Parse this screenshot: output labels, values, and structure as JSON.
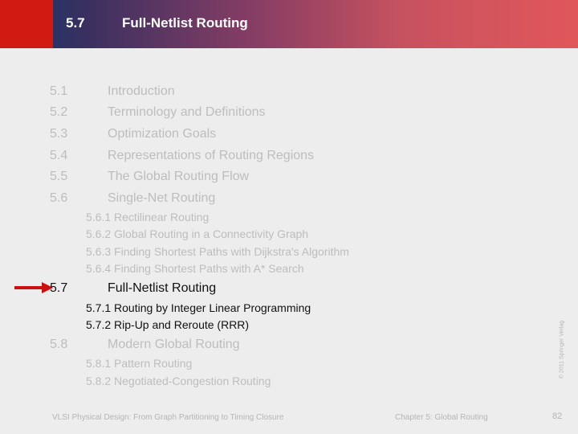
{
  "header": {
    "section_number": "5.7",
    "section_title": "Full-Netlist Routing",
    "colors": {
      "left_block": "#d01a12",
      "gradient_start": "#13386a",
      "gradient_end": "#e0575a"
    }
  },
  "toc": {
    "active_section": "5.7",
    "sections": [
      {
        "number": "5.1",
        "title": "Introduction",
        "subsections": []
      },
      {
        "number": "5.2",
        "title": "Terminology and Definitions",
        "subsections": []
      },
      {
        "number": "5.3",
        "title": "Optimization Goals",
        "subsections": []
      },
      {
        "number": "5.4",
        "title": "Representations of Routing Regions",
        "subsections": []
      },
      {
        "number": "5.5",
        "title": "The Global Routing Flow",
        "subsections": []
      },
      {
        "number": "5.6",
        "title": "Single-Net Routing",
        "subsections": [
          "5.6.1 Rectilinear Routing",
          "5.6.2 Global Routing in a Connectivity Graph",
          "5.6.3 Finding Shortest Paths with Dijkstra's Algorithm",
          "5.6.4 Finding Shortest Paths with A* Search"
        ]
      },
      {
        "number": "5.7",
        "title": "Full-Netlist Routing",
        "subsections": [
          "5.7.1 Routing by Integer Linear Programming",
          "5.7.2 Rip-Up and Reroute (RRR)"
        ]
      },
      {
        "number": "5.8",
        "title": "Modern Global Routing",
        "subsections": [
          "5.8.1 Pattern Routing",
          "5.8.2 Negotiated-Congestion Routing"
        ]
      }
    ]
  },
  "indicator": {
    "icon": "red-arrow-icon",
    "color": "#cc1010"
  },
  "footer": {
    "book_title": "VLSI Physical Design: From Graph Partitioning to Timing Closure",
    "chapter": "Chapter 5: Global Routing",
    "page_number": "82",
    "copyright": "© 2011 Springer Verlag"
  }
}
